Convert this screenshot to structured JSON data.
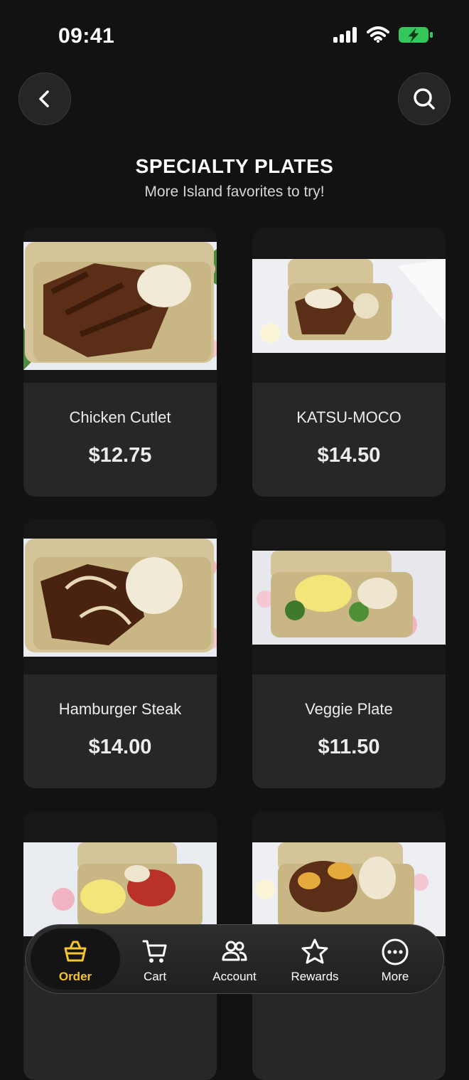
{
  "status": {
    "time": "09:41"
  },
  "header": {
    "title": "SPECIALTY PLATES",
    "subtitle": "More Island favorites to try!"
  },
  "products": [
    {
      "name": "Chicken Cutlet",
      "price": "$12.75"
    },
    {
      "name": "KATSU-MOCO",
      "price": "$14.50"
    },
    {
      "name": "Hamburger Steak",
      "price": "$14.00"
    },
    {
      "name": "Veggie Plate",
      "price": "$11.50"
    },
    {
      "name": "",
      "price": ""
    },
    {
      "name": "",
      "price": ""
    }
  ],
  "tabbar": {
    "items": [
      {
        "label": "Order",
        "icon": "basket-icon",
        "active": true
      },
      {
        "label": "Cart",
        "icon": "cart-icon",
        "active": false
      },
      {
        "label": "Account",
        "icon": "people-icon",
        "active": false
      },
      {
        "label": "Rewards",
        "icon": "star-icon",
        "active": false
      },
      {
        "label": "More",
        "icon": "more-icon",
        "active": false
      }
    ]
  },
  "colors": {
    "accent": "#f4c431",
    "battery": "#34c759",
    "background": "#121212",
    "card": "#272727"
  }
}
